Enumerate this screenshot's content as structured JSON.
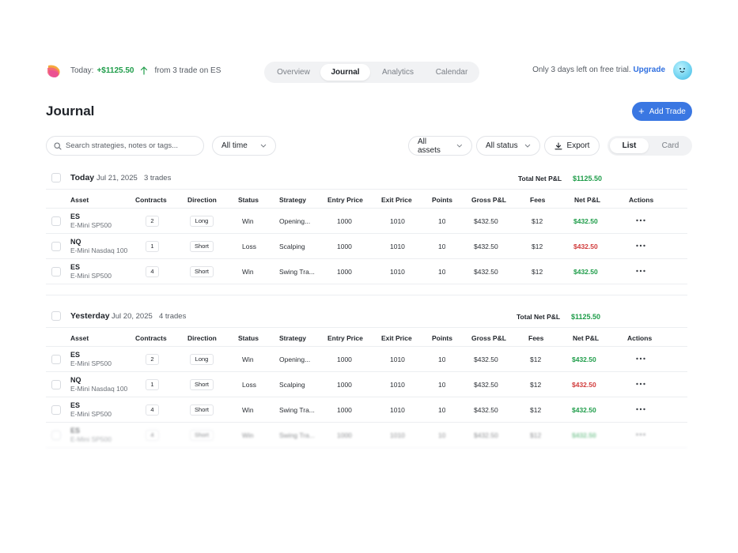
{
  "header": {
    "today_label": "Today:",
    "today_amount": "+$1125.50",
    "today_detail": "from 3 trade on ES",
    "tabs": [
      "Overview",
      "Journal",
      "Analytics",
      "Calendar"
    ],
    "active_tab": "Journal",
    "trial_text": "Only 3 days left on free trial.",
    "upgrade_label": "Upgrade"
  },
  "page": {
    "title": "Journal",
    "add_trade_label": "Add Trade"
  },
  "controls": {
    "search_placeholder": "Search strategies, notes or tags...",
    "time_filter": "All time",
    "assets_filter": "All assets",
    "status_filter": "All status",
    "export_label": "Export",
    "view_options": [
      "List",
      "Card"
    ],
    "active_view": "List"
  },
  "columns": [
    "Asset",
    "Contracts",
    "Direction",
    "Status",
    "Strategy",
    "Entry Price",
    "Exit Price",
    "Points",
    "Gross P&L",
    "Fees",
    "Net P&L",
    "Actions"
  ],
  "groups": [
    {
      "label": "Today",
      "date": "Jul 21, 2025",
      "count": "3 trades",
      "total_label": "Total Net P&L",
      "total_value": "$1125.50",
      "trades": [
        {
          "symbol": "ES",
          "name": "E-Mini SP500",
          "contracts": "2",
          "direction": "Long",
          "status": "Win",
          "strategy": "Opening...",
          "entry": "1000",
          "exit": "1010",
          "points": "10",
          "gross": "$432.50",
          "fees": "$12",
          "net": "$432.50",
          "net_sign": "pos"
        },
        {
          "symbol": "NQ",
          "name": "E-Mini Nasdaq 100",
          "contracts": "1",
          "direction": "Short",
          "status": "Loss",
          "strategy": "Scalping",
          "entry": "1000",
          "exit": "1010",
          "points": "10",
          "gross": "$432.50",
          "fees": "$12",
          "net": "$432.50",
          "net_sign": "neg"
        },
        {
          "symbol": "ES",
          "name": "E-Mini SP500",
          "contracts": "4",
          "direction": "Short",
          "status": "Win",
          "strategy": "Swing Tra...",
          "entry": "1000",
          "exit": "1010",
          "points": "10",
          "gross": "$432.50",
          "fees": "$12",
          "net": "$432.50",
          "net_sign": "pos"
        }
      ]
    },
    {
      "label": "Yesterday",
      "date": "Jul 20, 2025",
      "count": "4 trades",
      "total_label": "Total Net P&L",
      "total_value": "$1125.50",
      "trades": [
        {
          "symbol": "ES",
          "name": "E-Mini SP500",
          "contracts": "2",
          "direction": "Long",
          "status": "Win",
          "strategy": "Opening...",
          "entry": "1000",
          "exit": "1010",
          "points": "10",
          "gross": "$432.50",
          "fees": "$12",
          "net": "$432.50",
          "net_sign": "pos"
        },
        {
          "symbol": "NQ",
          "name": "E-Mini Nasdaq 100",
          "contracts": "1",
          "direction": "Short",
          "status": "Loss",
          "strategy": "Scalping",
          "entry": "1000",
          "exit": "1010",
          "points": "10",
          "gross": "$432.50",
          "fees": "$12",
          "net": "$432.50",
          "net_sign": "neg"
        },
        {
          "symbol": "ES",
          "name": "E-Mini SP500",
          "contracts": "4",
          "direction": "Short",
          "status": "Win",
          "strategy": "Swing Tra...",
          "entry": "1000",
          "exit": "1010",
          "points": "10",
          "gross": "$432.50",
          "fees": "$12",
          "net": "$432.50",
          "net_sign": "pos"
        },
        {
          "symbol": "ES",
          "name": "E-Mini SP500",
          "contracts": "4",
          "direction": "Short",
          "status": "Win",
          "strategy": "Swing Tra...",
          "entry": "1000",
          "exit": "1010",
          "points": "10",
          "gross": "$432.50",
          "fees": "$12",
          "net": "$432.50",
          "net_sign": "pos"
        }
      ]
    }
  ],
  "colors": {
    "accent": "#3a77e2",
    "positive": "#1f9d4a",
    "negative": "#d13c3c"
  },
  "icons": [
    "logo-icon",
    "arrow-up-icon",
    "avatar-icon",
    "plus-icon",
    "search-icon",
    "chevron-down-icon",
    "download-icon",
    "more-icon"
  ]
}
